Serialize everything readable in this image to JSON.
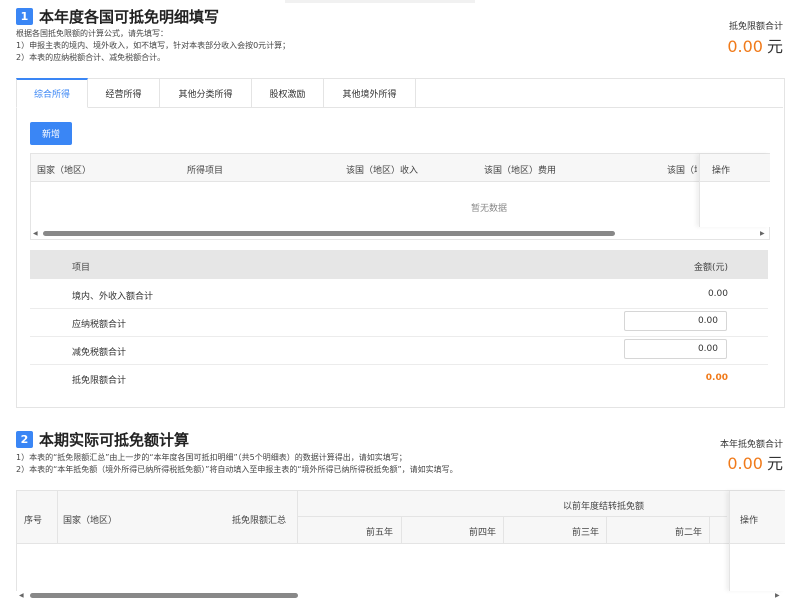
{
  "section1": {
    "num": "1",
    "title": "本年度各国可抵免明细填写",
    "desc": [
      "根据各国抵免限额的计算公式，请先填写：",
      "1）申报主表的境内、境外收入，如不填写，针对本表部分收入会按0元计算；",
      "2）本表的应纳税额合计、减免税额合计。"
    ],
    "summary_label": "抵免限额合计",
    "summary_value": "0.00",
    "summary_unit": "元",
    "tabs": [
      "综合所得",
      "经营所得",
      "其他分类所得",
      "股权激励",
      "其他境外所得"
    ],
    "active_tab": "综合所得",
    "add_button": "新增",
    "table_headers": [
      "国家（地区）",
      "所得项目",
      "该国（地区）收入",
      "该国（地区）费用",
      "该国（地"
    ],
    "op_header": "操作",
    "empty_text": "暂无数据",
    "summary_table": {
      "header_item": "项目",
      "header_amount": "金额(元)",
      "rows": [
        {
          "label": "境内、外收入额合计",
          "value": "0.00"
        },
        {
          "label": "应纳税额合计",
          "value": "0.00"
        },
        {
          "label": "减免税额合计",
          "value": "0.00"
        },
        {
          "label": "抵免限额合计",
          "value": "0.00"
        }
      ]
    }
  },
  "section2": {
    "num": "2",
    "title": "本期实际可抵免额计算",
    "desc": [
      "1）本表的“抵免限额汇总”由上一步的“本年度各国可抵扣明细”（共5个明细表）的数据计算得出，请如实填写；",
      "2）本表的“本年抵免额（境外所得已纳所得税抵免额）”将自动填入至申报主表的“境外所得已纳所得税抵免额”，请如实填写。"
    ],
    "summary_label": "本年抵免额合计",
    "summary_value": "0.00",
    "summary_unit": "元",
    "table": {
      "col_index": "序号",
      "col_country": "国家（地区）",
      "col_limit": "抵免限额汇总",
      "group_header": "以前年度结转抵免额",
      "sub_headers": [
        "前五年",
        "前四年",
        "前三年",
        "前二年"
      ],
      "op_header": "操作"
    }
  },
  "colors": {
    "accent": "#3a86f5",
    "orange": "#f07a1a"
  }
}
